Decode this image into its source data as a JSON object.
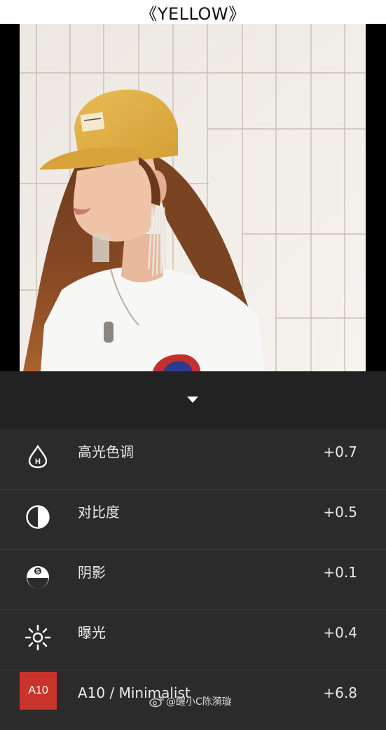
{
  "header": {
    "title": "《YELLOW》"
  },
  "photo": {
    "description_icon": "portrait-photo"
  },
  "adjustments": [
    {
      "icon": "highlights-icon",
      "label": "高光色调",
      "value": "+0.7"
    },
    {
      "icon": "contrast-icon",
      "label": "对比度",
      "value": "+0.5"
    },
    {
      "icon": "shadows-icon",
      "label": "阴影",
      "value": "+0.1"
    },
    {
      "icon": "exposure-icon",
      "label": "曝光",
      "value": "+0.4"
    },
    {
      "icon": "preset-badge",
      "label": "A10 / Minimalist",
      "value": "+6.8",
      "badge": "A10"
    }
  ],
  "watermark": {
    "text": "@醒小C陈漪璇"
  },
  "colors": {
    "panel": "#2b2b2b",
    "handle_bar": "#222222",
    "preset_badge": "#c8332b",
    "hat": "#e0b24a"
  }
}
